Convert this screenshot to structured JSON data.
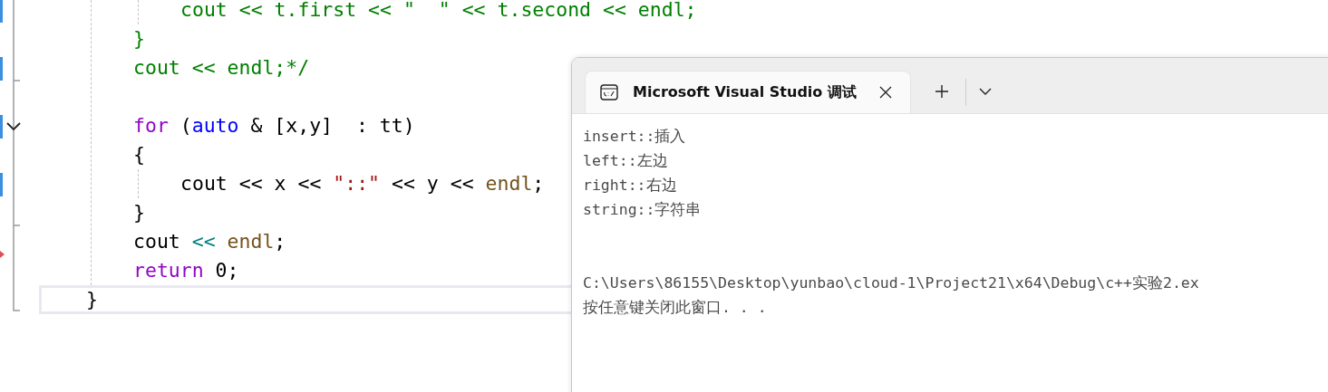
{
  "editor": {
    "code": [
      {
        "kind": "block",
        "children": [
          {
            "kind": "block",
            "children": [
              {
                "kind": "block",
                "children": [
                  {
                    "kind": "code",
                    "changed": true,
                    "current": false,
                    "tokens": [
                      {
                        "text": "cout << t.first << \"  \" << t.second << endl;",
                        "kind": "comment"
                      }
                    ]
                  }
                ]
              },
              {
                "kind": "code",
                "changed": false,
                "current": false,
                "tokens": [
                  {
                    "text": "}",
                    "kind": "comment"
                  }
                ]
              },
              {
                "kind": "code",
                "changed": true,
                "current": false,
                "tokens": [
                  {
                    "text": "cout << endl;*/",
                    "kind": "comment"
                  }
                ]
              },
              {
                "kind": "blank"
              },
              {
                "kind": "code",
                "changed": true,
                "current": false,
                "tokens": [
                  {
                    "text": "for",
                    "kind": "control"
                  },
                  {
                    "text": " (",
                    "kind": "plain"
                  },
                  {
                    "text": "auto",
                    "kind": "keyword"
                  },
                  {
                    "text": " & [x,y]  : tt)",
                    "kind": "plain"
                  }
                ]
              },
              {
                "kind": "code",
                "changed": false,
                "current": false,
                "tokens": [
                  {
                    "text": "{",
                    "kind": "plain"
                  }
                ]
              },
              {
                "kind": "block",
                "children": [
                  {
                    "kind": "code",
                    "changed": true,
                    "current": false,
                    "tokens": [
                      {
                        "text": "cout << x << ",
                        "kind": "plain"
                      },
                      {
                        "text": "\"::\"",
                        "kind": "string"
                      },
                      {
                        "text": " << y << ",
                        "kind": "plain"
                      },
                      {
                        "text": "endl",
                        "kind": "func"
                      },
                      {
                        "text": ";",
                        "kind": "plain"
                      }
                    ]
                  }
                ]
              },
              {
                "kind": "code",
                "changed": false,
                "current": false,
                "tokens": [
                  {
                    "text": "}",
                    "kind": "plain"
                  }
                ]
              },
              {
                "kind": "code",
                "changed": false,
                "current": false,
                "tokens": [
                  {
                    "text": "cout ",
                    "kind": "plain"
                  },
                  {
                    "text": "<<",
                    "kind": "operator"
                  },
                  {
                    "text": " endl",
                    "kind": "func"
                  },
                  {
                    "text": ";",
                    "kind": "plain"
                  }
                ]
              },
              {
                "kind": "code",
                "changed": false,
                "current": false,
                "tokens": [
                  {
                    "text": "return",
                    "kind": "control"
                  },
                  {
                    "text": " 0;",
                    "kind": "plain"
                  }
                ]
              }
            ]
          },
          {
            "kind": "code",
            "changed": false,
            "current": true,
            "tokens": [
              {
                "text": "}",
                "kind": "plain"
              }
            ]
          }
        ]
      }
    ]
  },
  "console": {
    "tab": {
      "title": "Microsoft Visual Studio 调试",
      "selected": true
    },
    "output_blocks": [
      {
        "lines": [
          "insert::插入",
          "left::左边",
          "right::右边",
          "string::字符串"
        ]
      },
      {
        "lines": [
          "C:\\Users\\86155\\Desktop\\yunbao\\cloud-1\\Project21\\x64\\Debug\\c++实验2.ex",
          "按任意键关闭此窗口. . ."
        ]
      }
    ]
  }
}
